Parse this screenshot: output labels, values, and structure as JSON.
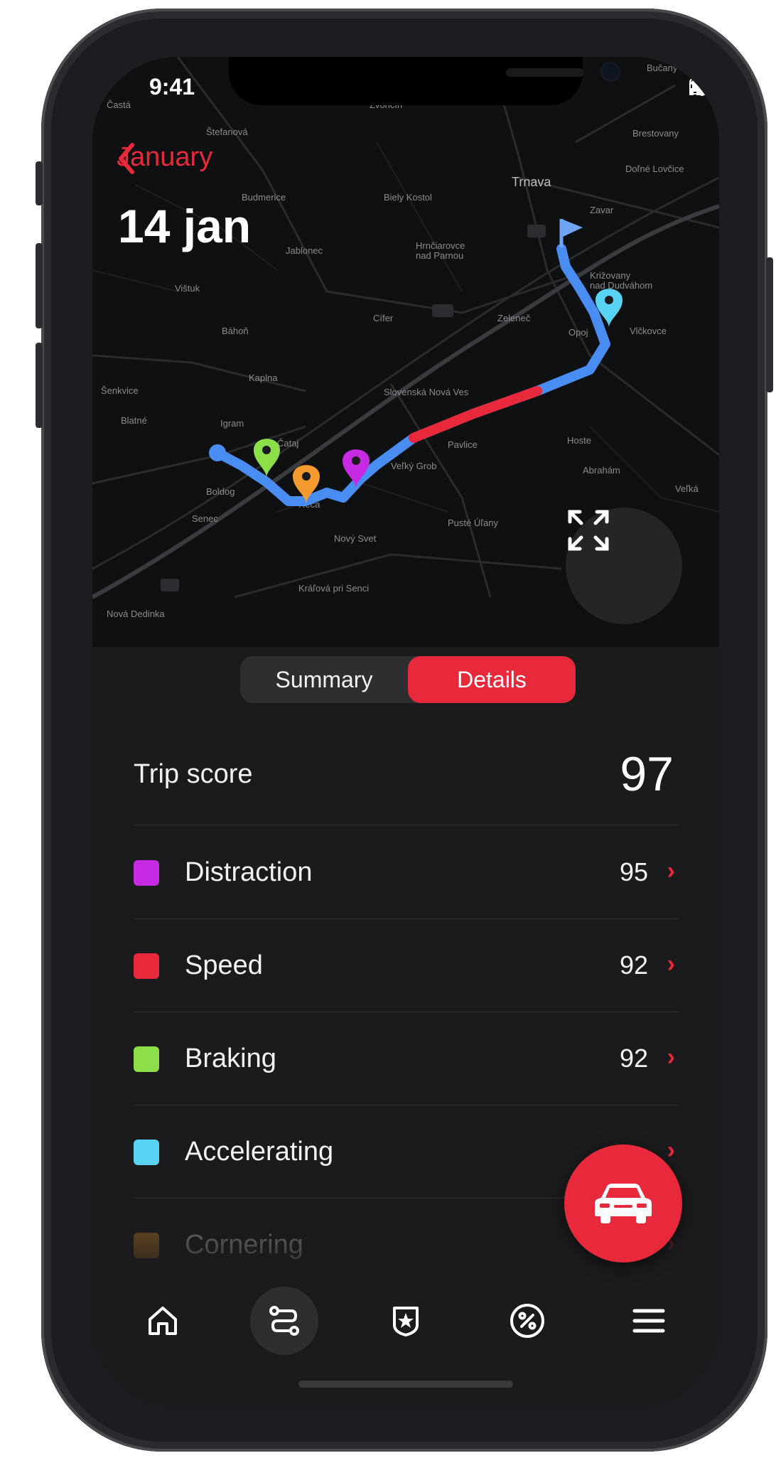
{
  "status_bar": {
    "time": "9:41"
  },
  "header": {
    "back_label": "January",
    "date": "14 jan"
  },
  "map": {
    "place_labels": [
      "Častá",
      "Štefanová",
      "Zvončín",
      "Bučany",
      "Brestovany",
      "Doľné Lovčice",
      "Trnava",
      "Zavar",
      "Budmerice",
      "Biely Kostol",
      "Jablonec",
      "Hrnčiarovce nad Parnou",
      "Vištuk",
      "Cífer",
      "Zeleneč",
      "Križovany nad Dudváhom",
      "Báhoň",
      "Opoj",
      "Vlčkovce",
      "Kaplna",
      "Slovenská Nová Ves",
      "Šenkvice",
      "Igram",
      "Čataj",
      "Pavlice",
      "Hoste",
      "Blatné",
      "Veľký Grob",
      "Abrahám",
      "Boldog",
      "Senec",
      "Reca",
      "Pusté Úľany",
      "Nový Svet",
      "Veľká",
      "Kráľová pri Senci",
      "Nová Dedinka"
    ],
    "colors": {
      "route": "#4a8df2",
      "speed_segment": "#e8293b"
    }
  },
  "tabs": {
    "summary": "Summary",
    "details": "Details",
    "active": "Details"
  },
  "trip_score": {
    "label": "Trip score",
    "value": "97"
  },
  "metrics": [
    {
      "label": "Distraction",
      "value": "95",
      "color": "#c62be3"
    },
    {
      "label": "Speed",
      "value": "92",
      "color": "#e8293b"
    },
    {
      "label": "Braking",
      "value": "92",
      "color": "#8ddf4a"
    },
    {
      "label": "Accelerating",
      "value": "",
      "color": "#59d3f4"
    },
    {
      "label": "Cornering",
      "value": "",
      "color": "#f39b2e"
    }
  ],
  "icons": {
    "back": "chevron-left-icon",
    "expand": "expand-icon",
    "car": "car-icon",
    "tab_bar": [
      "home-icon",
      "route-icon",
      "shield-star-icon",
      "percent-icon",
      "menu-icon"
    ]
  },
  "accent_color": "#e8293b"
}
